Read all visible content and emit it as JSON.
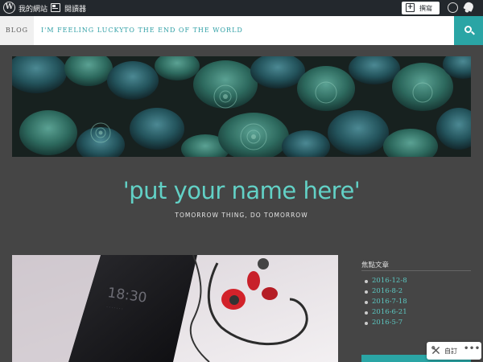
{
  "adminbar": {
    "my_site": "我的網站",
    "reader": "閱讀器",
    "write": "撰寫",
    "icons": [
      "wordpress-logo-icon",
      "reader-icon",
      "write-plus-icon",
      "avatar-icon",
      "notification-bell-icon"
    ]
  },
  "nav": {
    "items": [
      {
        "label": "BLOG"
      },
      {
        "label": "I'M FEELING LUCKY"
      },
      {
        "label": "TO THE END OF THE WORLD"
      }
    ],
    "search_icon": "search-icon"
  },
  "site": {
    "title": "'put your name here'",
    "tagline": "TOMORROW THING, DO TOMORROW"
  },
  "sidebar": {
    "widget_title": "焦點文章",
    "posts": [
      "2016-12-8",
      "2016-8-2",
      "2016-7-18",
      "2016-6-21",
      "2016-5-7"
    ]
  },
  "customize": {
    "label": "自訂",
    "more": "•••"
  },
  "colors": {
    "accent": "#2aa5a5",
    "title": "#62d1c6",
    "background": "#454545",
    "adminbar": "#23282d"
  }
}
